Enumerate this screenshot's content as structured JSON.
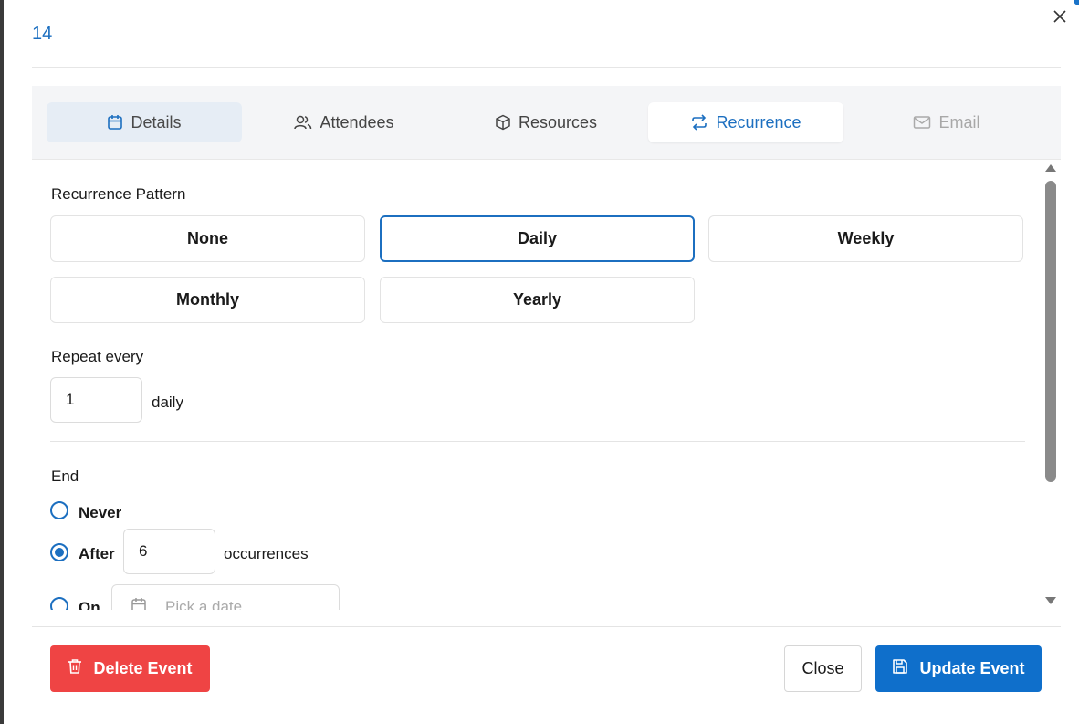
{
  "dialog": {
    "title": "14"
  },
  "tabs": [
    {
      "label": "Details",
      "icon": "calendar-icon"
    },
    {
      "label": "Attendees",
      "icon": "users-icon"
    },
    {
      "label": "Resources",
      "icon": "box-icon"
    },
    {
      "label": "Recurrence",
      "icon": "repeat-icon"
    },
    {
      "label": "Email",
      "icon": "mail-icon"
    }
  ],
  "recurrence": {
    "pattern_label": "Recurrence Pattern",
    "patterns": [
      "None",
      "Daily",
      "Weekly",
      "Monthly",
      "Yearly"
    ],
    "selected_pattern": "Daily",
    "repeat_label": "Repeat every",
    "repeat_value": "1",
    "repeat_unit": "daily",
    "end_label": "End",
    "end_options": {
      "never": "Never",
      "after": "After",
      "on": "On"
    },
    "selected_end": "After",
    "occurrences_value": "6",
    "occurrences_label": "occurrences",
    "date_placeholder": "Pick a date"
  },
  "footer": {
    "delete_label": "Delete Event",
    "close_label": "Close",
    "update_label": "Update Event"
  },
  "colors": {
    "accent": "#1c6fc0",
    "danger": "#ef4444",
    "primary": "#0f6fcb"
  }
}
